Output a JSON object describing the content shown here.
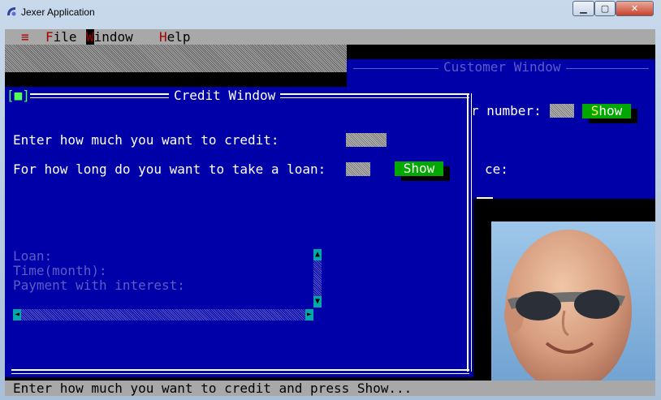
{
  "window": {
    "title": "Jexer Application",
    "controls": {
      "minimize": "▁",
      "maximize": "▢",
      "close": "✕"
    }
  },
  "menubar": {
    "system_glyph": "≡",
    "items": [
      {
        "hot": "F",
        "rest": "ile"
      },
      {
        "hot": "W",
        "rest": "indow"
      },
      {
        "hot": "H",
        "rest": "elp"
      }
    ]
  },
  "customer_window": {
    "title": "Customer Window",
    "number_label": "r number:",
    "show_button": {
      "hot": "S",
      "rest": "how"
    },
    "partial_text": "ce:"
  },
  "credit_window": {
    "title": "Credit Window",
    "close_glyph": "[■]",
    "credit_prompt": "Enter how much you want to credit:",
    "loan_prompt": "For how long do you want to take a loan:",
    "show_button": {
      "label": "Show"
    },
    "results": {
      "loan_label": "Loan:",
      "time_label": "Time(month):",
      "payment_label": "Payment with interest:"
    },
    "scroll_up": "▲",
    "scroll_down": "▼",
    "scroll_left": "◄",
    "scroll_right": "►"
  },
  "statusbar": {
    "text": "Enter how much you want to credit and press Show..."
  },
  "colors": {
    "terminal_blue": "#0000a8",
    "button_green": "#00a800",
    "hotkey_red": "#a80000",
    "menubar_gray": "#a8a8a8"
  }
}
